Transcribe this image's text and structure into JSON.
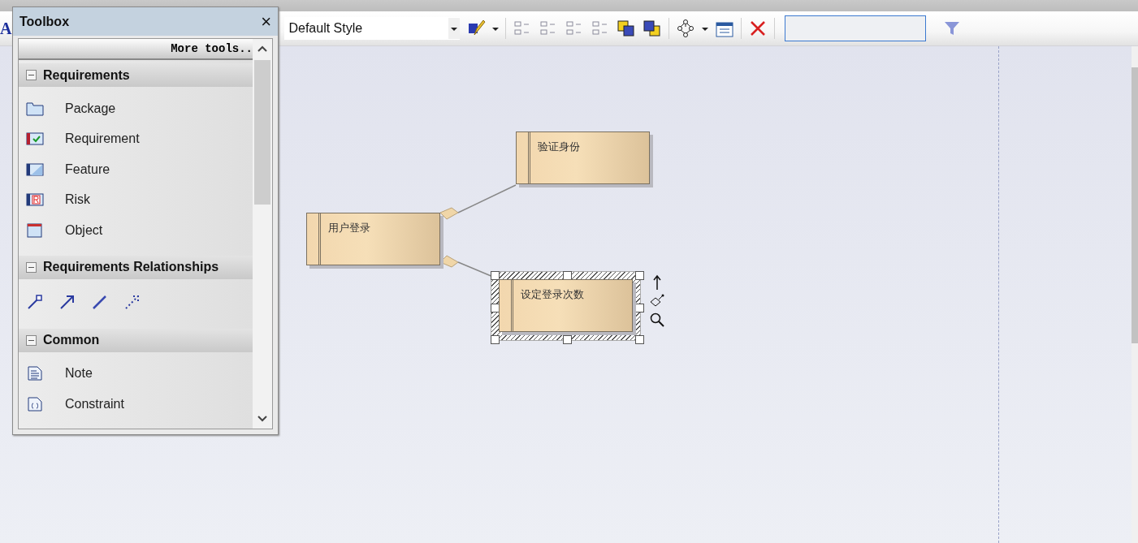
{
  "toolbar": {
    "glyph": "A",
    "style_select": {
      "value": "Default Style"
    }
  },
  "toolbox": {
    "title": "Toolbox",
    "close": "×",
    "more_tools": "More tools..",
    "groups": [
      {
        "title": "Requirements",
        "expanded": true,
        "items": [
          {
            "kind": "package",
            "label": "Package"
          },
          {
            "kind": "requirement",
            "label": "Requirement"
          },
          {
            "kind": "feature",
            "label": "Feature"
          },
          {
            "kind": "risk",
            "label": "Risk"
          },
          {
            "kind": "object",
            "label": "Object"
          }
        ]
      },
      {
        "title": "Requirements Relationships",
        "expanded": true,
        "items": [
          {
            "kind": "realize"
          },
          {
            "kind": "trace"
          },
          {
            "kind": "aggregate"
          },
          {
            "kind": "dependency"
          }
        ]
      },
      {
        "title": "Common",
        "expanded": true,
        "items": [
          {
            "kind": "note",
            "label": "Note"
          },
          {
            "kind": "constraint",
            "label": "Constraint"
          }
        ]
      }
    ]
  },
  "diagram": {
    "nodes": [
      {
        "name": "用户登录",
        "selected": false
      },
      {
        "name": "验证身份",
        "selected": false
      },
      {
        "name": "设定登录次数",
        "selected": true
      }
    ],
    "connectors": [
      {
        "kind": "aggregation"
      },
      {
        "kind": "aggregation"
      }
    ]
  }
}
